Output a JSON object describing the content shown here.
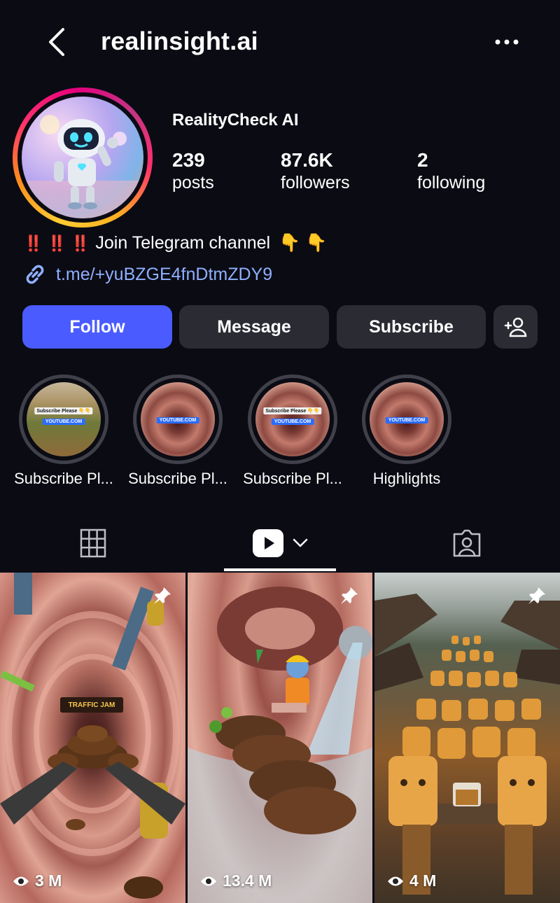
{
  "header": {
    "username": "realinsight.ai"
  },
  "profile": {
    "display_name": "RealityCheck AI",
    "stats": [
      {
        "value": "239",
        "label": "posts"
      },
      {
        "value": "87.6K",
        "label": "followers"
      },
      {
        "value": "2",
        "label": "following"
      }
    ],
    "bio": "Join Telegram channel",
    "bio_prefix": "‼️ ‼️ ‼️",
    "bio_suffix": "👇 👇",
    "link": "t.me/+yuBZGE4fnDtmZDY9"
  },
  "actions": {
    "follow": "Follow",
    "message": "Message",
    "subscribe": "Subscribe"
  },
  "highlights": [
    {
      "label": "Subscribe Pl...",
      "banner": "Subscribe Please 👇👇",
      "yt": "YOUTUBE.COM"
    },
    {
      "label": "Subscribe Pl...",
      "banner": "",
      "yt": "YOUTUBE.COM"
    },
    {
      "label": "Subscribe Pl...",
      "banner": "Subscribe Please 👇👇",
      "yt": "YOUTUBE.COM"
    },
    {
      "label": "Highlights",
      "banner": "",
      "yt": "YOUTUBE.COM"
    }
  ],
  "tabs": [
    "grid-icon",
    "reels-icon",
    "tagged-icon"
  ],
  "posts": [
    {
      "views": "3 M",
      "sign": "TRAFFIC JAM"
    },
    {
      "views": "13.4 M"
    },
    {
      "views": "4 M"
    }
  ],
  "colors": {
    "background": "#0b0b14",
    "follow": "#4a5cff",
    "button_gray": "#2a2b33",
    "link": "#8fb0ff"
  }
}
